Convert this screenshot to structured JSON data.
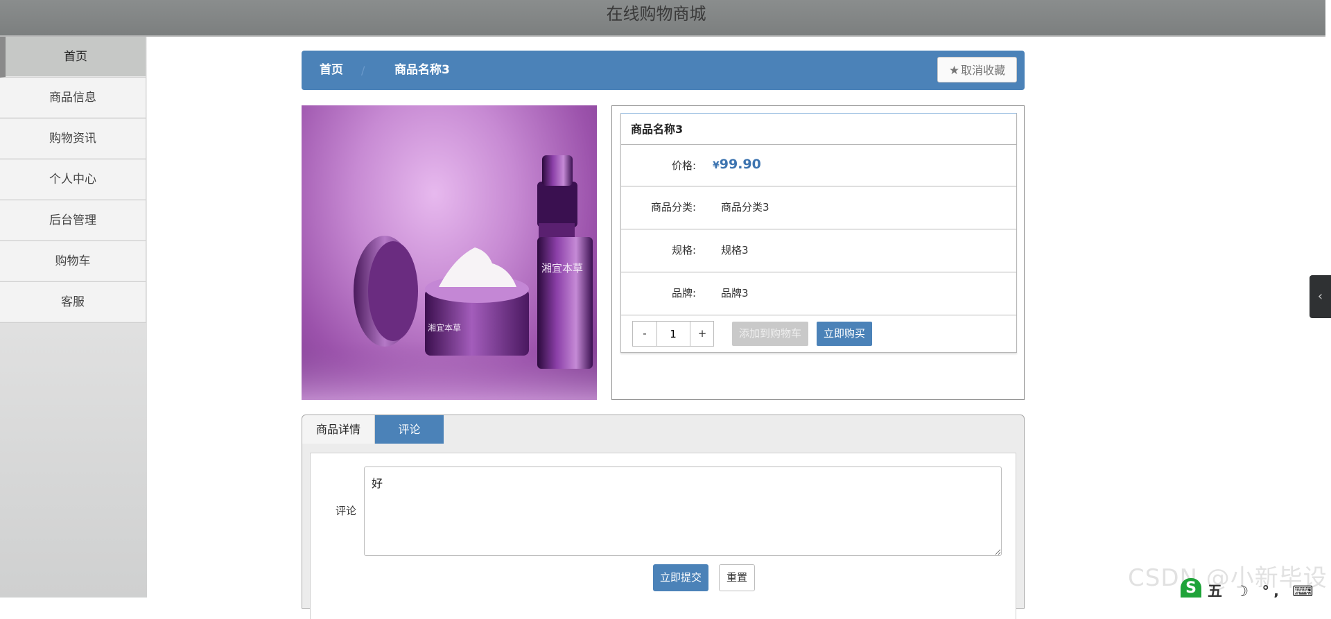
{
  "header": {
    "title": "在线购物商城"
  },
  "sidebar": {
    "items": [
      {
        "label": "首页"
      },
      {
        "label": "商品信息"
      },
      {
        "label": "购物资讯"
      },
      {
        "label": "个人中心"
      },
      {
        "label": "后台管理"
      },
      {
        "label": "购物车"
      },
      {
        "label": "客服"
      }
    ]
  },
  "breadcrumb": {
    "home": "首页",
    "current": "商品名称3",
    "separator": "/"
  },
  "favorite": {
    "label": "取消收藏"
  },
  "product": {
    "name": "商品名称3",
    "price_label": "价格:",
    "currency": "¥",
    "price": "99.90",
    "category_label": "商品分类:",
    "category": "商品分类3",
    "spec_label": "规格:",
    "spec": "规格3",
    "brand_label": "品牌:",
    "brand": "品牌3",
    "image_brand_text": "湘宜本草"
  },
  "quantity": {
    "minus": "-",
    "value": "1",
    "plus": "+"
  },
  "actions": {
    "add_to_cart": "添加到购物车",
    "buy_now": "立即购买"
  },
  "tabs": {
    "detail": "商品详情",
    "comment": "评论"
  },
  "comment_form": {
    "label": "评论",
    "value": "好",
    "submit": "立即提交",
    "reset": "重置"
  },
  "watermark": "CSDN @小新毕设",
  "ime": {
    "text": "五 ☽ °, ⌨ ♟ ⁝"
  },
  "colors": {
    "primary": "#4b82b8",
    "topbar": "#838686",
    "accent_price": "#3d74b0"
  },
  "icons": {
    "favorite": "star-icon",
    "collapse": "chevron-left-icon"
  }
}
